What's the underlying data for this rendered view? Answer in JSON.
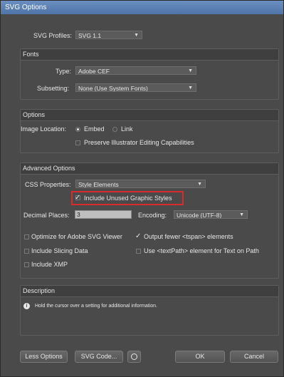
{
  "window": {
    "title": "SVG Options"
  },
  "svg_profiles": {
    "label": "SVG Profiles:",
    "value": "SVG 1.1"
  },
  "fonts": {
    "section_label": "Fonts",
    "type_label": "Type:",
    "type_value": "Adobe CEF",
    "subsetting_label": "Subsetting:",
    "subsetting_value": "None (Use System Fonts)"
  },
  "options": {
    "section_label": "Options",
    "image_location_label": "Image Location:",
    "embed_label": "Embed",
    "link_label": "Link",
    "preserve_label": "Preserve Illustrator Editing Capabilities"
  },
  "advanced": {
    "section_label": "Advanced Options",
    "css_label": "CSS Properties:",
    "css_value": "Style Elements",
    "include_unused_label": "Include Unused Graphic Styles",
    "decimal_label": "Decimal Places:",
    "decimal_value": "3",
    "encoding_label": "Encoding:",
    "encoding_value": "Unicode (UTF-8)",
    "optimize_label": "Optimize for Adobe SVG Viewer",
    "fewer_tspan_label": "Output fewer <tspan> elements",
    "slicing_label": "Include Slicing Data",
    "textpath_label": "Use <textPath> element for Text on Path",
    "xmp_label": "Include XMP"
  },
  "description": {
    "section_label": "Description",
    "text": "Hold the cursor over a setting for additional information."
  },
  "buttons": {
    "less_options": "Less Options",
    "svg_code": "SVG Code...",
    "ok": "OK",
    "cancel": "Cancel"
  },
  "colors": {
    "highlight": "#d92b2b",
    "background": "#4a4a4a"
  }
}
